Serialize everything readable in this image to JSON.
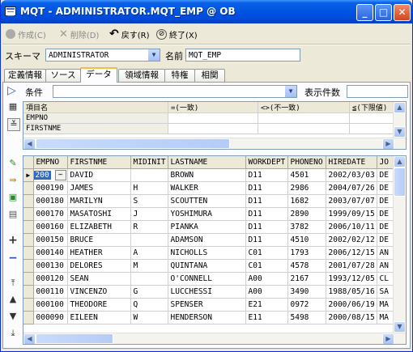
{
  "window": {
    "title": "MQT - ADMINISTRATOR.MQT_EMP @ OB"
  },
  "toolbar": {
    "create": "作成(C)",
    "delete": "削除(D)",
    "revert": "戻す(R)",
    "exit": "終了(X)"
  },
  "form": {
    "schema_label": "スキーマ",
    "schema_value": "ADMINISTRATOR",
    "name_label": "名前",
    "name_value": "MQT_EMP"
  },
  "tabs": [
    {
      "label": "定義情報"
    },
    {
      "label": "ソース"
    },
    {
      "label": "データ"
    },
    {
      "label": "領域情報"
    },
    {
      "label": "特権"
    },
    {
      "label": "相関"
    }
  ],
  "condition": {
    "label": "条件",
    "value": "",
    "rows_label": "表示件数",
    "rows_value": ""
  },
  "filter_grid": {
    "headers": [
      "項目名",
      "=(一致)",
      "<>(不一致)",
      "≦(下限値)"
    ],
    "rows": [
      [
        "EMPNO",
        "",
        "",
        ""
      ],
      [
        "FIRSTNME",
        "",
        "",
        ""
      ]
    ]
  },
  "data_grid": {
    "headers": [
      "EMPNO",
      "FIRSTNME",
      "MIDINIT",
      "LASTNAME",
      "WORKDEPT",
      "PHONENO",
      "HIREDATE",
      "JO"
    ],
    "rows": [
      [
        "200",
        "DAVID",
        "",
        "BROWN",
        "D11",
        "4501",
        "2002/03/03",
        "DE"
      ],
      [
        "000190",
        "JAMES",
        "H",
        "WALKER",
        "D11",
        "2986",
        "2004/07/26",
        "DE"
      ],
      [
        "000180",
        "MARILYN",
        "S",
        "SCOUTTEN",
        "D11",
        "1682",
        "2003/07/07",
        "DE"
      ],
      [
        "000170",
        "MASATOSHI",
        "J",
        "YOSHIMURA",
        "D11",
        "2890",
        "1999/09/15",
        "DE"
      ],
      [
        "000160",
        "ELIZABETH",
        "R",
        "PIANKA",
        "D11",
        "3782",
        "2006/10/11",
        "DE"
      ],
      [
        "000150",
        "BRUCE",
        "",
        "ADAMSON",
        "D11",
        "4510",
        "2002/02/12",
        "DE"
      ],
      [
        "000140",
        "HEATHER",
        "A",
        "NICHOLLS",
        "C01",
        "1793",
        "2006/12/15",
        "AN"
      ],
      [
        "000130",
        "DELORES",
        "M",
        "QUINTANA",
        "C01",
        "4578",
        "2001/07/28",
        "AN"
      ],
      [
        "000120",
        "SEAN",
        "",
        "O'CONNELL",
        "A00",
        "2167",
        "1993/12/05",
        "CL"
      ],
      [
        "000110",
        "VINCENZO",
        "G",
        "LUCCHESSI",
        "A00",
        "3490",
        "1988/05/16",
        "SA"
      ],
      [
        "000100",
        "THEODORE",
        "Q",
        "SPENSER",
        "E21",
        "0972",
        "2000/06/19",
        "MA"
      ],
      [
        "000090",
        "EILEEN",
        "W",
        "HENDERSON",
        "E11",
        "5498",
        "2000/08/15",
        "MA"
      ]
    ]
  },
  "icons": {
    "window": "window-app-icon",
    "create": "circle-icon",
    "delete": "x-icon",
    "revert": "undo-arrow-icon",
    "exit": "no-entry-icon",
    "execute": "play-triangle-icon",
    "filter_side": [
      "grid-icon",
      "collapse-icon"
    ],
    "data_side": [
      "edit-pencil-icon",
      "insert-row-icon",
      "copy-icon",
      "paste-icon",
      "add-icon",
      "remove-icon",
      "first-icon",
      "up-icon",
      "down-icon",
      "last-icon"
    ]
  },
  "colors": {
    "title_bar": "#0054e3",
    "tab_accent": "#f7b94a",
    "selected_cell": "#316ac5"
  }
}
